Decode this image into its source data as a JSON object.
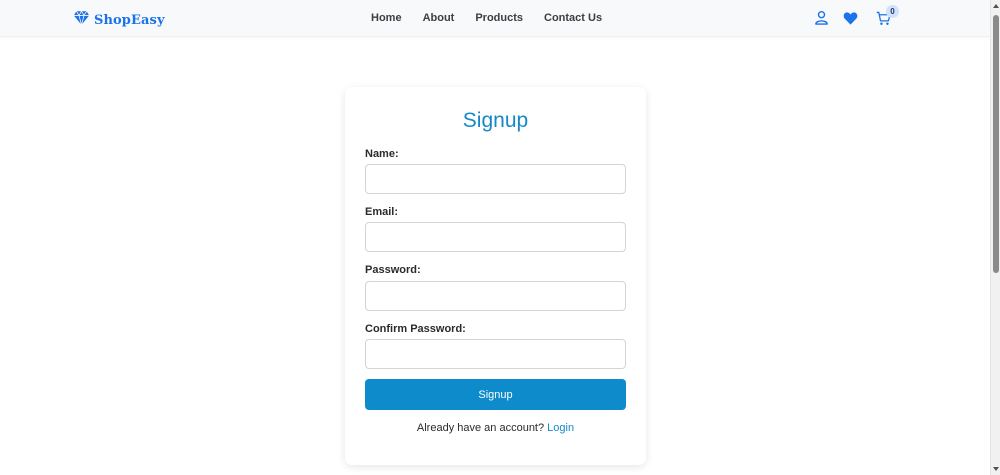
{
  "brand": {
    "name": "ShopEasy",
    "icon": "diamond-icon",
    "color": "#1a73e8"
  },
  "nav": {
    "links": [
      "Home",
      "About",
      "Products",
      "Contact Us"
    ],
    "icons": [
      "user-icon",
      "heart-icon",
      "cart-icon"
    ],
    "cart_count": "0"
  },
  "form": {
    "title": "Signup",
    "fields": [
      {
        "label": "Name:",
        "value": ""
      },
      {
        "label": "Email:",
        "value": ""
      },
      {
        "label": "Password:",
        "value": ""
      },
      {
        "label": "Confirm Password:",
        "value": ""
      }
    ],
    "submit_label": "Signup",
    "footer_text": "Already have an account?",
    "footer_link": "Login"
  },
  "colors": {
    "accent": "#1589c6",
    "button": "#0d8bcb",
    "icon": "#1a73e8"
  }
}
